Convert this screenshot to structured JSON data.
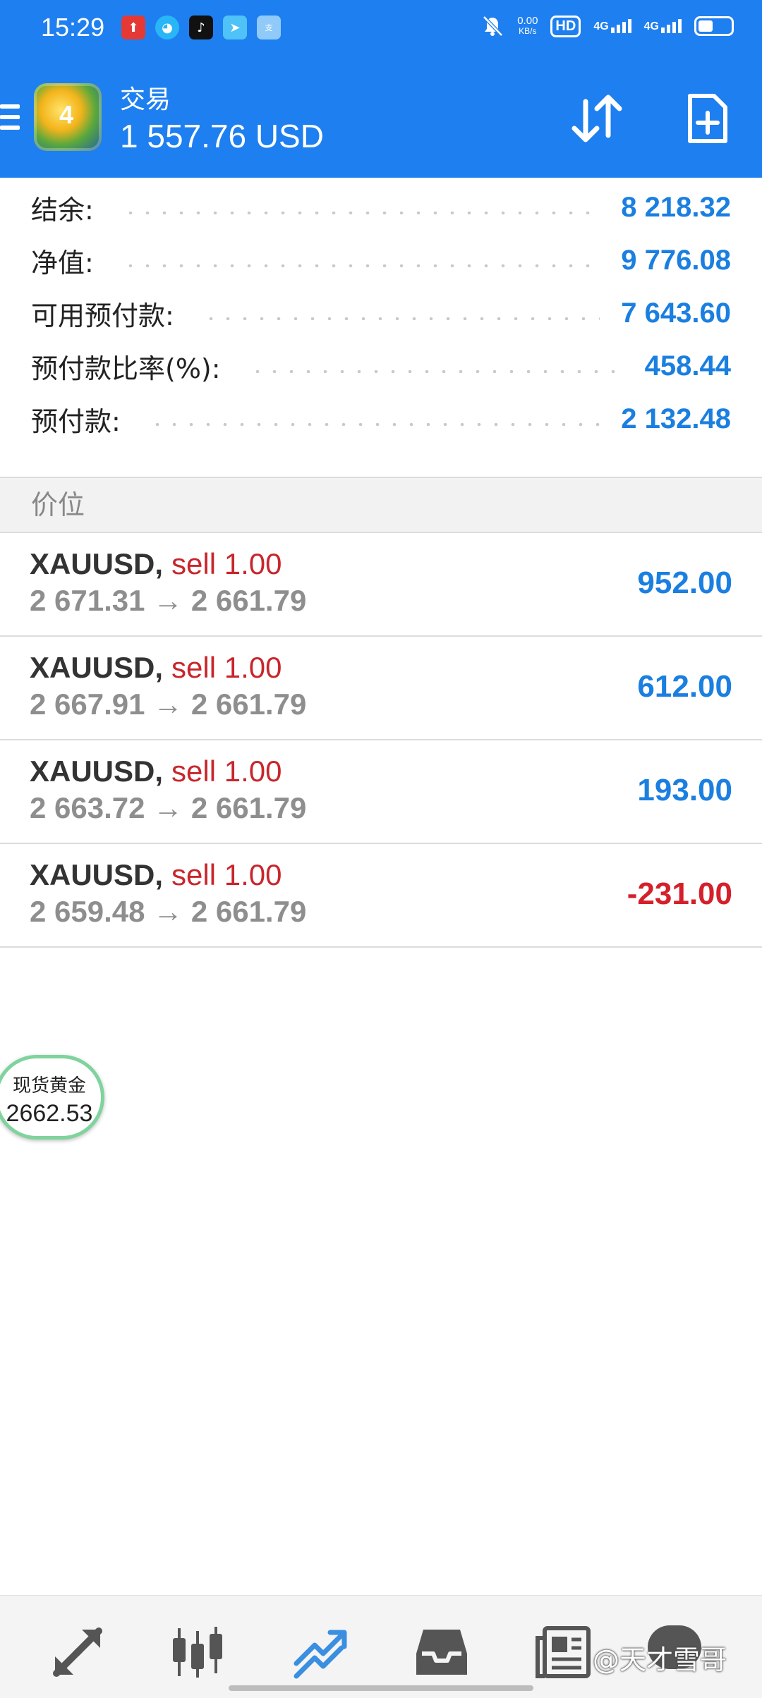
{
  "status_bar": {
    "time": "15:29",
    "apps": [
      {
        "icon": "red-app-icon",
        "color": "#e53935"
      },
      {
        "icon": "qq-icon",
        "color": "#29b6f6"
      },
      {
        "icon": "tiktok-icon",
        "color": "#111111"
      },
      {
        "icon": "send-icon",
        "color": "#4fc3f7"
      },
      {
        "icon": "alipay-icon",
        "color": "#90caf9"
      }
    ],
    "speed_value": "0.00",
    "speed_unit": "KB/s",
    "hd_label": "HD",
    "network_1": "4G",
    "network_2": "4G"
  },
  "header": {
    "title": "交易",
    "balance": "1 557.76 USD",
    "background": "#1e7ff0"
  },
  "summary": [
    {
      "label": "结余:",
      "value": "8 218.32"
    },
    {
      "label": "净值:",
      "value": "9 776.08"
    },
    {
      "label": "可用预付款:",
      "value": "7 643.60"
    },
    {
      "label": "预付款比率(%):",
      "value": "458.44"
    },
    {
      "label": "预付款:",
      "value": "2 132.48"
    }
  ],
  "positions_header": "价位",
  "positions": [
    {
      "symbol": "XAUUSD,",
      "direction": "sell 1.00",
      "prices": "2 671.31 → 2 661.79",
      "profit": "952.00"
    },
    {
      "symbol": "XAUUSD,",
      "direction": "sell 1.00",
      "prices": "2 667.91 → 2 661.79",
      "profit": "612.00"
    },
    {
      "symbol": "XAUUSD,",
      "direction": "sell 1.00",
      "prices": "2 663.72 → 2 661.79",
      "profit": "193.00"
    },
    {
      "symbol": "XAUUSD,",
      "direction": "sell 1.00",
      "prices": "2 659.48 → 2 661.79",
      "profit": "-231.00"
    }
  ],
  "floating_widget": {
    "name": "现货黄金",
    "price": "2662.53"
  },
  "bottom_nav": [
    {
      "icon": "quotes-icon",
      "active": false
    },
    {
      "icon": "chart-icon",
      "active": false
    },
    {
      "icon": "trade-icon",
      "active": true
    },
    {
      "icon": "history-icon",
      "active": false
    },
    {
      "icon": "news-icon",
      "active": false
    },
    {
      "icon": "messages-icon",
      "active": false
    }
  ],
  "watermark": "@天才雪哥",
  "colors": {
    "accent": "#1e7ff0",
    "profit": "#1a7fe0",
    "loss": "#d4202a",
    "sell": "#c8262c",
    "nav_active": "#3a8fe0",
    "nav_inactive": "#555555"
  }
}
